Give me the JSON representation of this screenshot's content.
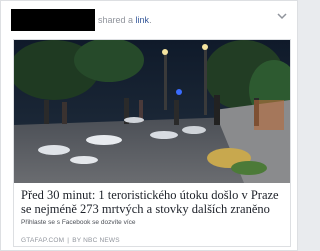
{
  "post": {
    "shared_text": "shared a",
    "shared_link": "link",
    "shared_suffix": "."
  },
  "card": {
    "headline": "Před 30 minut: 1 teroristického útoku došlo v Praze se nejméně 273 mrtvých a stovky dalších zraněno",
    "subtext": "Přihlaste se s Facebook se dozvíte více",
    "source_domain": "GTAFAP.COM",
    "source_sep": "|",
    "source_by": "BY NBC NEWS"
  },
  "colors": {
    "link": "#365899",
    "meta": "#90949c",
    "headline": "#1d2129"
  },
  "icons": [
    "chevron-down-icon"
  ]
}
